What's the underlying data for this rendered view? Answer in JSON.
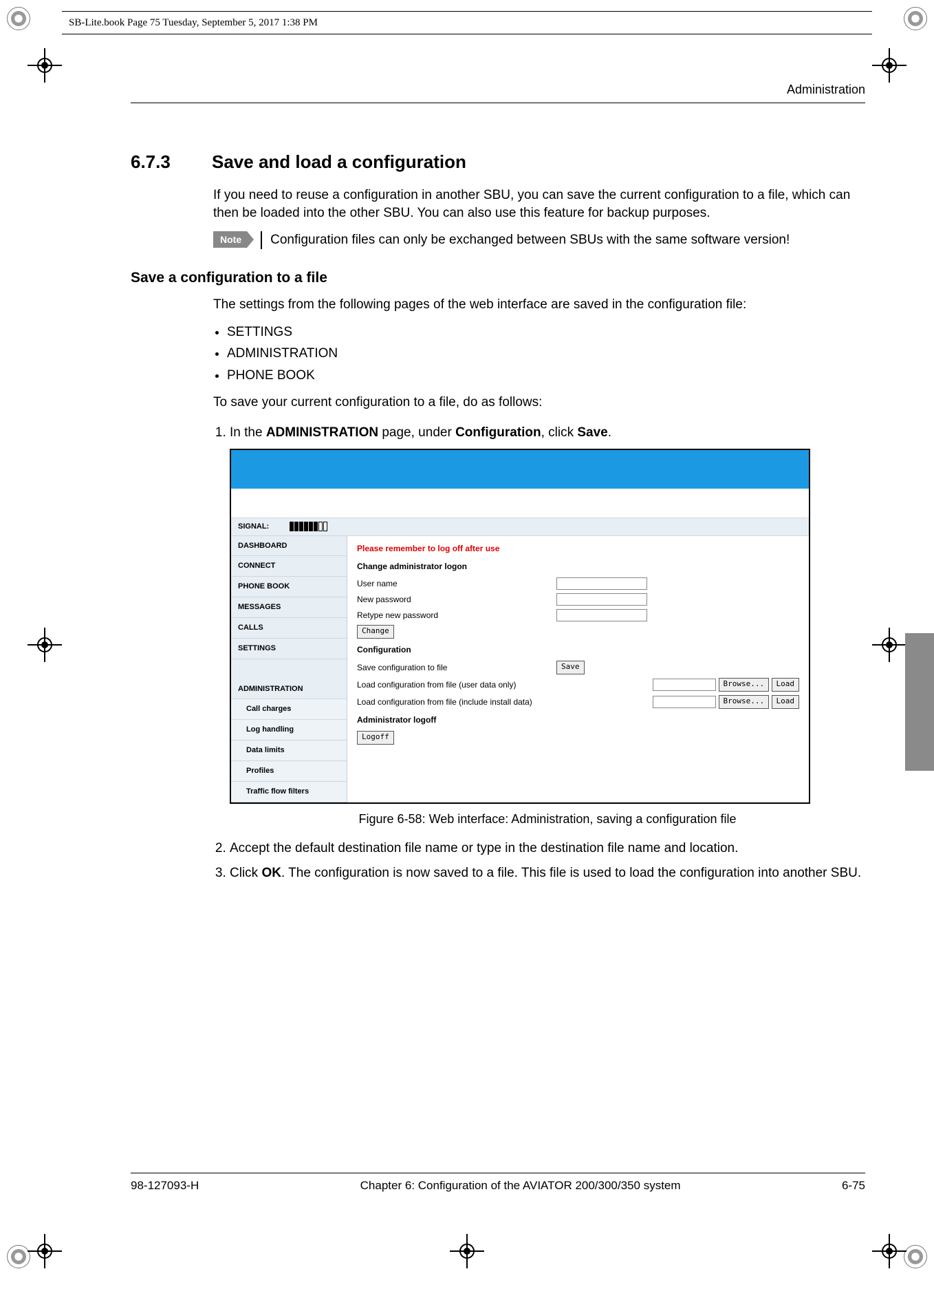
{
  "print_header": "SB-Lite.book  Page 75  Tuesday, September 5, 2017  1:38 PM",
  "running_head": "Administration",
  "section": {
    "num": "6.7.3",
    "title": "Save and load a configuration"
  },
  "intro": "If you need to reuse a configuration in another SBU, you can save the current configuration to a file, which can then be loaded into the other SBU. You can also use this feature for backup purposes.",
  "note_label": "Note",
  "note_text": "Configuration files can only be exchanged between SBUs with the same software version!",
  "h4_save": "Save a configuration to a file",
  "save_intro": "The settings from the following pages of the web interface are saved in the configuration file:",
  "bullets": [
    "SETTINGS",
    "ADMINISTRATION",
    "PHONE BOOK"
  ],
  "save_follow": "To save your current configuration to a file, do as follows:",
  "step1_pre": "In the ",
  "step1_bold1": "ADMINISTRATION",
  "step1_mid": " page, under ",
  "step1_bold2": "Configuration",
  "step1_mid2": ", click ",
  "step1_bold3": "Save",
  "step1_post": ".",
  "figure": {
    "signal_label": "SIGNAL:",
    "nav": [
      "DASHBOARD",
      "CONNECT",
      "PHONE BOOK",
      "MESSAGES",
      "CALLS",
      "SETTINGS",
      "ADMINISTRATION"
    ],
    "subnav": [
      "Call charges",
      "Log handling",
      "Data limits",
      "Profiles",
      "Traffic flow filters"
    ],
    "warn": "Please remember to log off after use",
    "grp_logon": "Change administrator logon",
    "lbl_user": "User name",
    "lbl_newpw": "New password",
    "lbl_retype": "Retype new password",
    "btn_change": "Change",
    "grp_config": "Configuration",
    "lbl_save": "Save configuration to file",
    "btn_save": "Save",
    "lbl_load_user": "Load configuration from file (user data only)",
    "lbl_load_install": "Load configuration from file (include install data)",
    "btn_browse": "Browse...",
    "btn_load": "Load",
    "grp_logoff": "Administrator logoff",
    "btn_logoff": "Logoff"
  },
  "figure_caption": "Figure 6-58: Web interface: Administration, saving a configuration file",
  "step2": "Accept the default destination file name or type in the destination file name and location.",
  "step3_pre": "Click ",
  "step3_bold": "OK",
  "step3_post": ". The configuration is now saved to a file. This file is used to load the configuration into another SBU.",
  "footer": {
    "left": "98-127093-H",
    "center": "Chapter 6:  Configuration of the AVIATOR 200/300/350 system",
    "right": "6-75"
  }
}
